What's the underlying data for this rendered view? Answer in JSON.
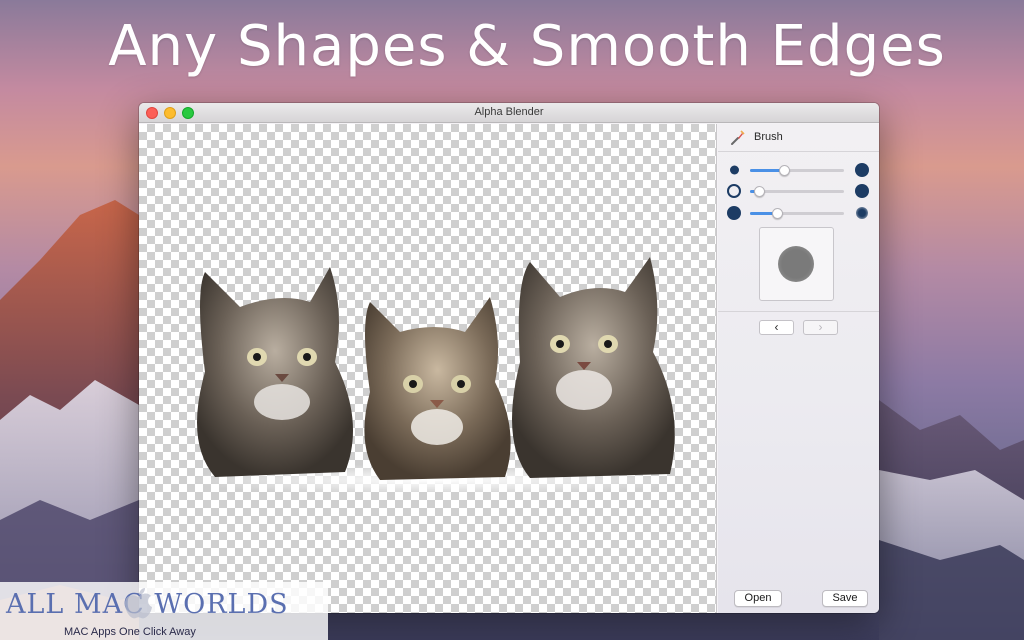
{
  "headline": "Any Shapes & Smooth Edges",
  "window": {
    "title": "Alpha Blender"
  },
  "panel": {
    "title": "Brush",
    "icon": "brush-icon",
    "sliders": [
      {
        "name": "size",
        "value": 0.35,
        "left_icon": "small-dot-icon",
        "right_icon": "large-dot-icon"
      },
      {
        "name": "hardness",
        "value": 0.05,
        "left_icon": "hollow-circle-icon",
        "right_icon": "solid-circle-icon"
      },
      {
        "name": "softness",
        "value": 0.27,
        "left_icon": "hard-dot-icon",
        "right_icon": "soft-dot-icon"
      }
    ],
    "prev_label": "‹",
    "next_label": "›",
    "open_label": "Open",
    "save_label": "Save"
  },
  "colors": {
    "accent": "#4a90e6",
    "slider_icon": "#1d3c64"
  },
  "watermark": {
    "title": "ALL MAC WORLDS",
    "subtitle": "MAC Apps One Click Away"
  }
}
